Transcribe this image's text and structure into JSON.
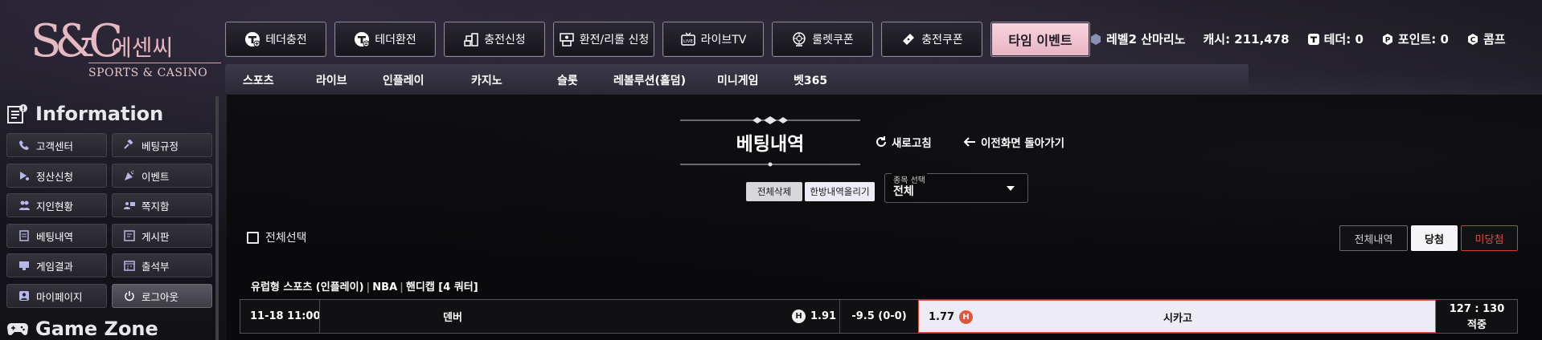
{
  "brand": {
    "logo_mark": "S&C",
    "name_kr": "에센씨",
    "name_en": "SPORTS & CASINO"
  },
  "top_nav": [
    {
      "label": "테더충전",
      "icon": "tether-plus-icon"
    },
    {
      "label": "테더환전",
      "icon": "tether-exchange-icon"
    },
    {
      "label": "충전신청",
      "icon": "coin-stack-icon"
    },
    {
      "label": "환전/리롤 신청",
      "icon": "exchange-machine-icon"
    },
    {
      "label": "라이브TV",
      "icon": "live-tv-icon"
    },
    {
      "label": "룰렛쿠폰",
      "icon": "roulette-icon"
    },
    {
      "label": "충전쿠폰",
      "icon": "ticket-icon"
    }
  ],
  "event_button": "타임 이벤트",
  "user": {
    "level": "레벨2 산마리노",
    "cash": "캐시: 211,478",
    "tether": "테더: 0",
    "points": "포인트: 0",
    "comp": "콤프"
  },
  "sub_nav": [
    "스포츠",
    "라이브",
    "인플레이",
    "카지노",
    "슬롯",
    "레볼루션(홀덤)",
    "미니게임",
    "벳365"
  ],
  "sidebar": {
    "info_title": "Information",
    "items": [
      {
        "label": "고객센터",
        "icon": "phone-icon"
      },
      {
        "label": "베팅규정",
        "icon": "gavel-icon"
      },
      {
        "label": "정산신청",
        "icon": "settle-icon"
      },
      {
        "label": "이벤트",
        "icon": "party-icon"
      },
      {
        "label": "지인현황",
        "icon": "people-icon"
      },
      {
        "label": "쪽지함",
        "icon": "message-icon"
      },
      {
        "label": "베팅내역",
        "icon": "receipt-icon"
      },
      {
        "label": "게시판",
        "icon": "board-icon"
      },
      {
        "label": "게임결과",
        "icon": "result-icon"
      },
      {
        "label": "출석부",
        "icon": "attendance-icon"
      },
      {
        "label": "마이페이지",
        "icon": "user-icon"
      },
      {
        "label": "로그아웃",
        "icon": "power-icon"
      }
    ],
    "game_title": "Game Zone"
  },
  "page": {
    "title": "베팅내역",
    "refresh": "새로고침",
    "back": "이전화면 돌아가기",
    "delete_all": "전체삭제",
    "upload_all": "한방내역올리기",
    "select_label": "종목 선택",
    "select_value": "전체",
    "select_all": "전체선택",
    "filter_all": "전체내역",
    "filter_win": "당첨",
    "filter_lose": "미당첨"
  },
  "bet": {
    "meta_type": "유럽형 스포츠 (인플레이)",
    "meta_league": "NBA",
    "meta_market": "핸디캡 [4 쿼터]",
    "time": "11-18 11:00",
    "home": "덴버",
    "home_badge": "H",
    "home_odds": "1.91",
    "handicap": "-9.5 (0-0)",
    "away_odds": "1.77",
    "away_badge": "H",
    "away": "시카고",
    "score": "127 : 130",
    "result": "적중"
  },
  "colors": {
    "accent_pink": "#f9d4de",
    "lose_red": "#e24848",
    "selected_bg": "#ecebf6"
  }
}
